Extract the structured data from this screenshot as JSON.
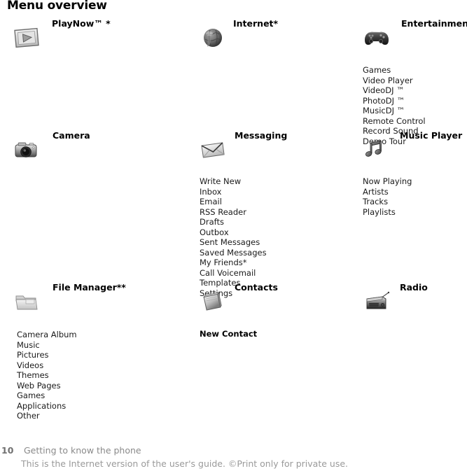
{
  "document": {
    "title": "Menu overview"
  },
  "groups": [
    {
      "id": "playnow",
      "title": "PlayNow™ *",
      "icon": "play-media-icon",
      "items": []
    },
    {
      "id": "internet",
      "title": "Internet*",
      "icon": "globe-icon",
      "items": []
    },
    {
      "id": "entertainment",
      "title": "Entertainment",
      "icon": "gamepad-icon",
      "items": [
        "Games",
        "Video Player",
        "VideoDJ ™",
        "PhotoDJ ™",
        "MusicDJ ™",
        "Remote Control",
        "Record Sound",
        "Demo Tour"
      ]
    },
    {
      "id": "camera",
      "title": "Camera",
      "icon": "camera-icon",
      "items": []
    },
    {
      "id": "messaging",
      "title": "Messaging",
      "icon": "envelope-icon",
      "items": [
        "Write New",
        "Inbox",
        "Email",
        "RSS Reader",
        "Drafts",
        "Outbox",
        "Sent Messages",
        "Saved Messages",
        "My Friends*",
        "Call Voicemail",
        "Templates",
        "Settings"
      ]
    },
    {
      "id": "music-player",
      "title": "Music Player",
      "icon": "music-note-icon",
      "items": [
        "Now Playing",
        "Artists",
        "Tracks",
        "Playlists"
      ]
    },
    {
      "id": "file-manager",
      "title": "File Manager**",
      "icon": "folder-icon",
      "items": [
        "Camera Album",
        "Music",
        "Pictures",
        "Videos",
        "Themes",
        "Web Pages",
        "Games",
        "Applications",
        "Other"
      ]
    },
    {
      "id": "contacts",
      "title": "Contacts",
      "icon": "address-book-icon",
      "items": [
        "New Contact"
      ]
    },
    {
      "id": "radio",
      "title": "Radio",
      "icon": "radio-icon",
      "items": []
    }
  ],
  "footer": {
    "page_number": "10",
    "section": "Getting to know the phone",
    "notice": "This is the Internet version of the user's guide. ©Print only for private use."
  }
}
